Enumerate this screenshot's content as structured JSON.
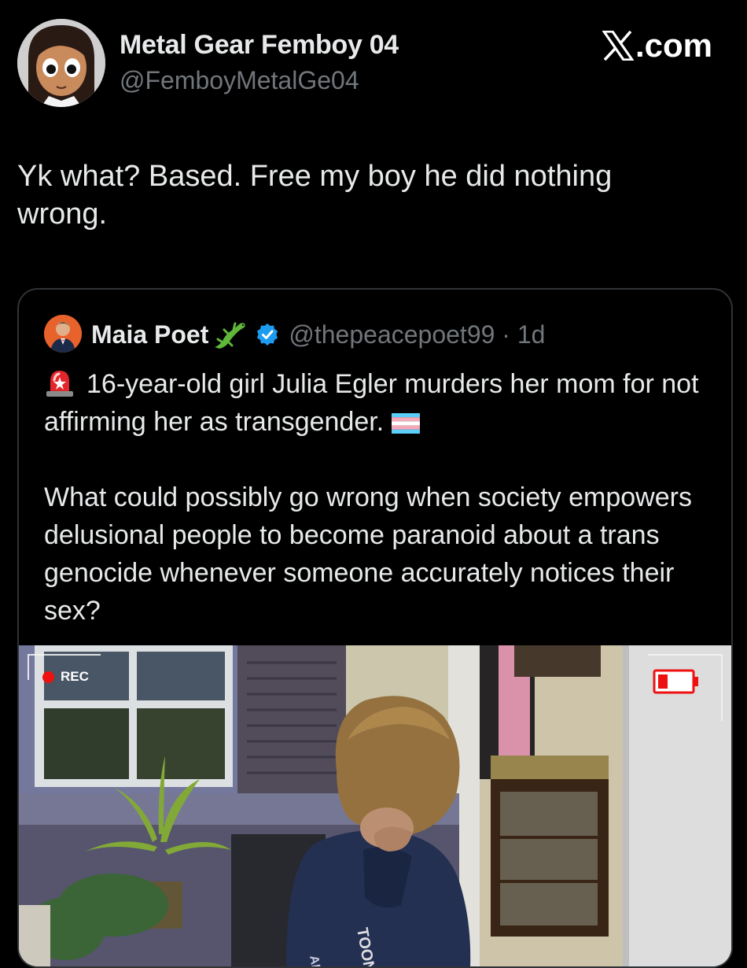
{
  "author": {
    "display_name": "Metal Gear Femboy 04",
    "handle": "@FemboyMetalGe04",
    "avatar_icon": "anime-girl-avatar"
  },
  "brand": {
    "label": ".com",
    "icon": "x-logo-icon"
  },
  "tweet": {
    "text": "Yk what? Based. Free my boy he did nothing wrong."
  },
  "quote": {
    "display_name": "Maia Poet",
    "handle_time": "@thepeacepoet99 · 1d",
    "lizard_icon": "lizard-emoji-icon",
    "verified_icon": "verified-badge-icon",
    "paragraph1": "16-year-old girl Julia Egler murders her mom for not affirming her as transgender.",
    "paragraph2": "What could possibly go wrong when society empowers delusional people to become paranoid about a trans genocide whenever someone accurately notices their sex?",
    "siren_icon": "police-siren-emoji-icon",
    "flag_icon": "transgender-flag-emoji-icon"
  },
  "media": {
    "rec_label": "REC",
    "battery_icon": "low-battery-icon",
    "colors": {
      "rec": "#ee1111",
      "battery": "#e11111"
    }
  },
  "colors": {
    "background": "#000000",
    "primary_text": "#e7e9ea",
    "secondary_text": "#71767b",
    "border": "#2f3336",
    "verified": "#1d9bf0"
  }
}
